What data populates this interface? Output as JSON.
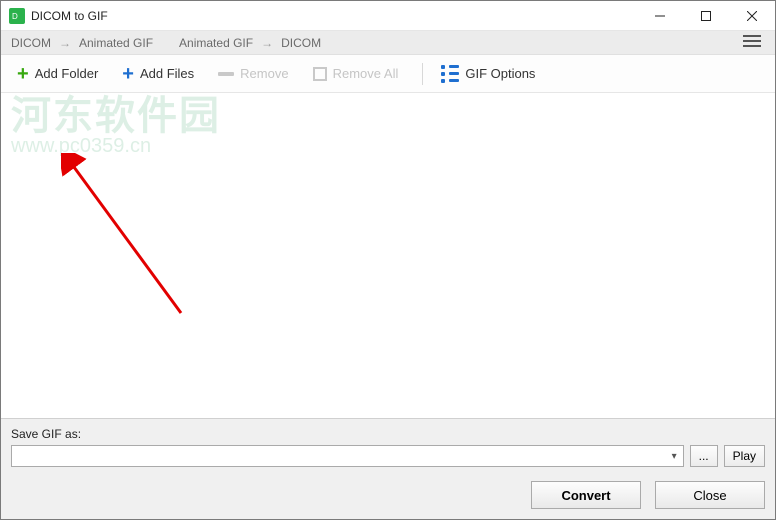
{
  "window": {
    "title": "DICOM to GIF"
  },
  "breadcrumbs": {
    "a1": "DICOM",
    "a2": "Animated GIF",
    "b1": "Animated GIF",
    "b2": "DICOM"
  },
  "toolbar": {
    "add_folder": "Add Folder",
    "add_files": "Add Files",
    "remove": "Remove",
    "remove_all": "Remove All",
    "gif_options": "GIF Options"
  },
  "watermark": {
    "line1": "河东软件园",
    "line2": "www.pc0359.cn"
  },
  "bottom": {
    "save_label": "Save GIF as:",
    "save_path": "",
    "browse": "...",
    "play": "Play",
    "convert": "Convert",
    "close": "Close"
  }
}
